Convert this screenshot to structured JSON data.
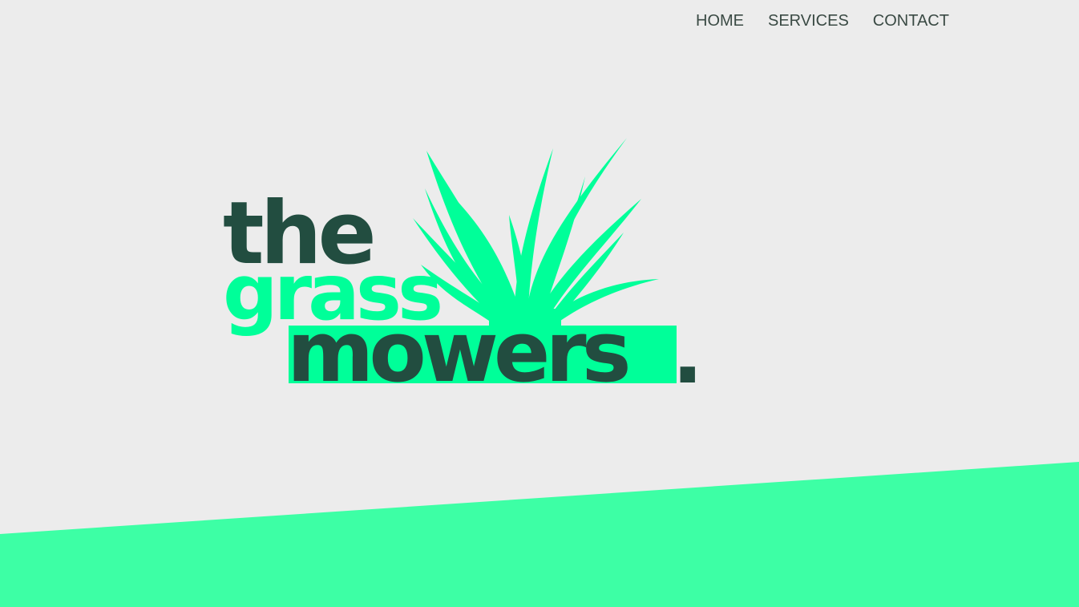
{
  "nav": {
    "items": [
      {
        "label": "HOME"
      },
      {
        "label": "SERVICES"
      },
      {
        "label": "CONTACT"
      }
    ]
  },
  "logo": {
    "word_the": "the",
    "word_grass": "grass",
    "word_mowers": "mowers",
    "dot": ".",
    "icon": "grass-icon"
  },
  "colors": {
    "background": "#ececec",
    "brand_dark": "#224d40",
    "brand_green": "#00ff99",
    "band_green": "#3dffa5",
    "nav_text": "#3a4a44"
  }
}
